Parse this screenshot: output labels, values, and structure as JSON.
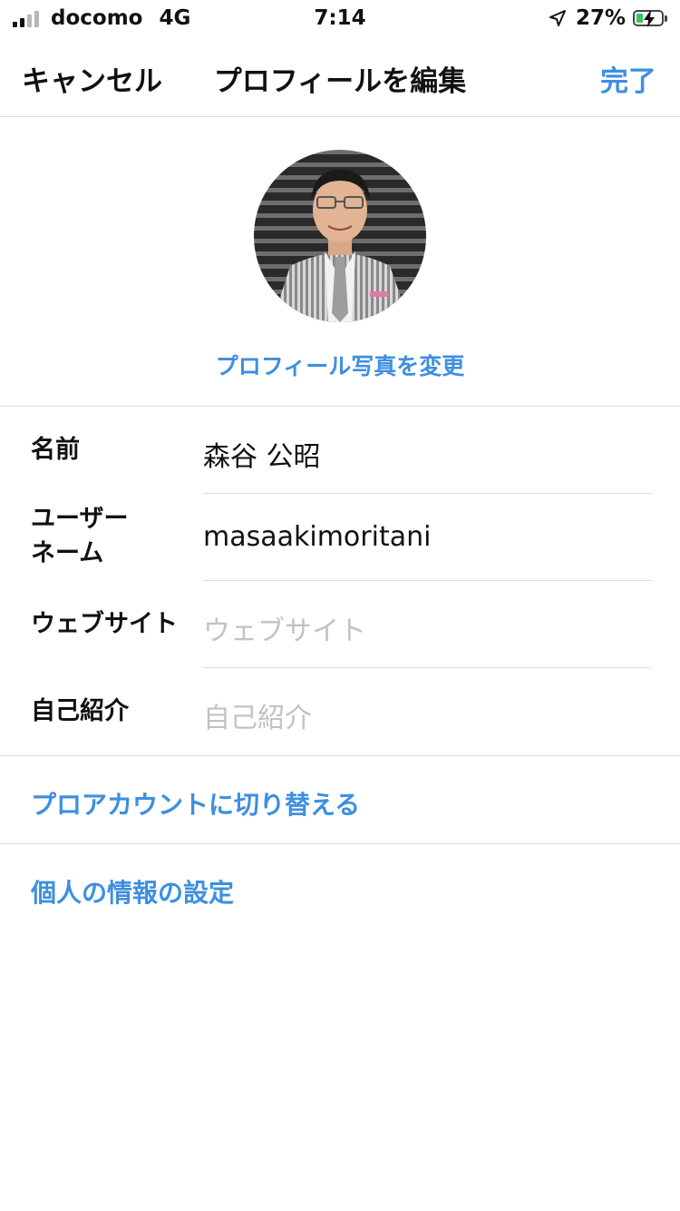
{
  "status_bar": {
    "carrier": "docomo",
    "network": "4G",
    "time": "7:14",
    "battery_percent": "27%",
    "signal_bars_filled": 2,
    "signal_bars_total": 4,
    "battery_level": 0.27,
    "charging": true
  },
  "nav": {
    "cancel_label": "キャンセル",
    "title": "プロフィールを編集",
    "done_label": "完了"
  },
  "profile": {
    "change_photo_label": "プロフィール写真を変更"
  },
  "form": {
    "name": {
      "label": "名前",
      "value": "森谷 公昭"
    },
    "username": {
      "label_line1": "ユーザー",
      "label_line2": "ネーム",
      "value": "masaakimoritani"
    },
    "website": {
      "label": "ウェブサイト",
      "placeholder": "ウェブサイト"
    },
    "bio": {
      "label": "自己紹介",
      "placeholder": "自己紹介"
    }
  },
  "links": {
    "pro_account": "プロアカウントに切り替える",
    "personal_info": "個人の情報の設定"
  },
  "colors": {
    "accent": "#3d8fe0",
    "text": "#111111",
    "placeholder": "#c2c2c2",
    "divider": "#dcdcdc",
    "battery_fill": "#34c759"
  },
  "icons": {
    "location": "location-arrow-icon",
    "battery": "battery-icon",
    "charging": "charging-bolt-icon",
    "signal": "cellular-signal-icon"
  }
}
